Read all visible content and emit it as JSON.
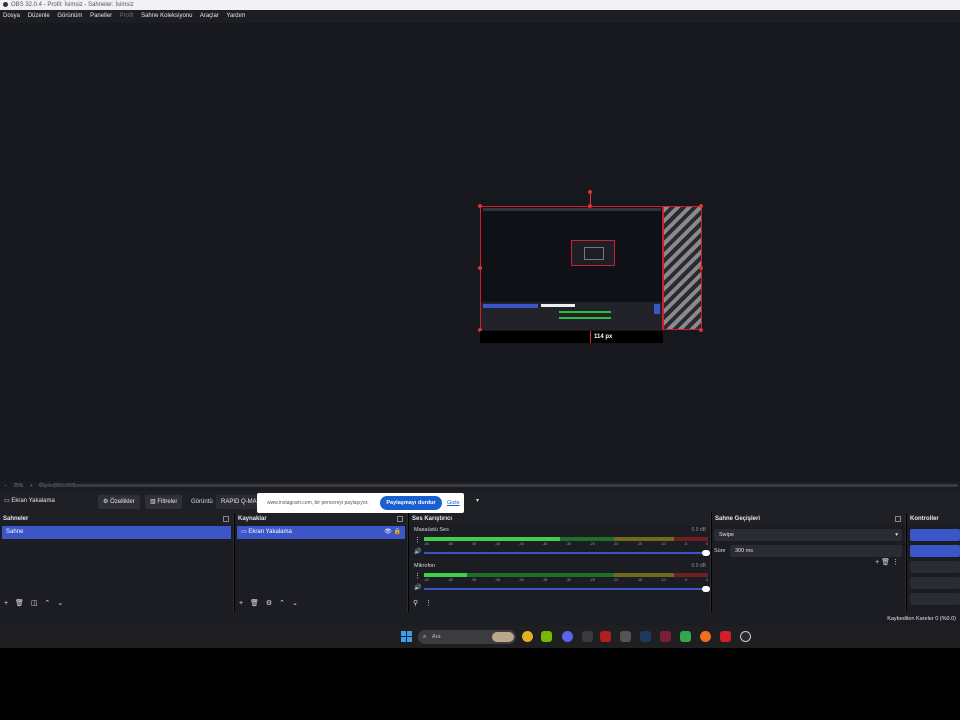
{
  "window": {
    "title": "OBS 32.0.4 - Profil: İsimsiz - Sahneler: İsimsiz"
  },
  "menu": [
    {
      "label": "Dosya",
      "enabled": true
    },
    {
      "label": "Düzenle",
      "enabled": true
    },
    {
      "label": "Görünüm",
      "enabled": true
    },
    {
      "label": "Paneller",
      "enabled": true
    },
    {
      "label": "Profil",
      "enabled": false
    },
    {
      "label": "Sahne Koleksiyonu",
      "enabled": true
    },
    {
      "label": "Araçlar",
      "enabled": true
    },
    {
      "label": "Yardım",
      "enabled": true
    }
  ],
  "preview": {
    "measure_label": "114 px"
  },
  "zoombar": {
    "minus": "−",
    "zoom": "25%",
    "plus": "+",
    "size": "Ölçek (654x367)",
    "caret": "▾"
  },
  "sourcebar": {
    "selected_source": "Ekran Yakalama",
    "properties": "Özellikler",
    "filters": "Filtreler",
    "display_label": "Görüntü",
    "display_value": "RAPID Q-MA"
  },
  "share": {
    "message": "www.instagram.com, bir pencereyi paylaşıyor.",
    "stop": "Paylaşmayı durdur",
    "hide": "Gizle"
  },
  "scenes": {
    "title": "Sahneler",
    "items": [
      "Sahne"
    ]
  },
  "sources": {
    "title": "Kaynaklar",
    "items": [
      "Ekran Yakalama"
    ]
  },
  "mixer": {
    "title": "Ses Karıştırıcı",
    "ticks": [
      "-60",
      "-55",
      "-50",
      "-45",
      "-40",
      "-35",
      "-30",
      "-25",
      "-20",
      "-15",
      "-10",
      "-5",
      "0"
    ],
    "channels": [
      {
        "name": "Masaüstü Ses",
        "db": "0.0 dB",
        "level": 0.48
      },
      {
        "name": "Mikrofon",
        "db": "0.0 dB",
        "level": 0.15
      }
    ]
  },
  "transitions": {
    "title": "Sahne Geçişleri",
    "type": "Swipe",
    "duration_label": "Süre",
    "duration_value": "300 ms"
  },
  "controls": {
    "title": "Kontroller"
  },
  "status": {
    "dropped": "Kaybedilen Kareler 0 (%0.0)"
  },
  "taskbar": {
    "search_placeholder": "Ara"
  },
  "colors": {
    "accent": "#3c56c8",
    "selection_red": "#d21e2a",
    "meter_green": "#3fd04a"
  }
}
